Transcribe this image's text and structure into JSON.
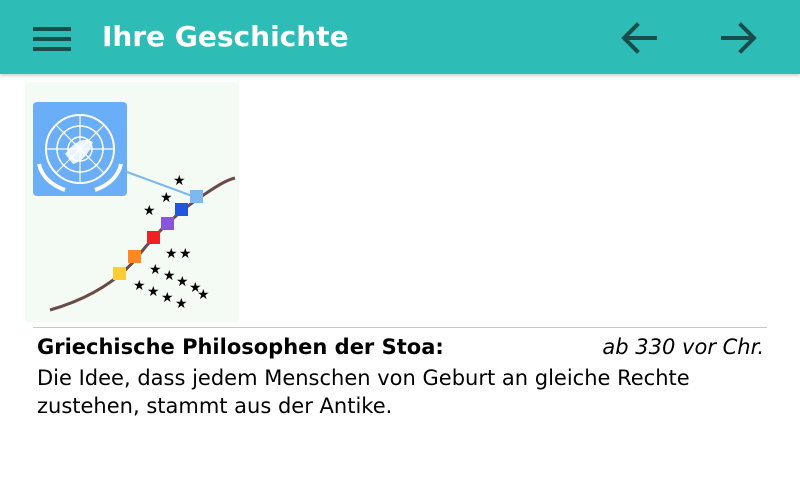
{
  "app_bar": {
    "title": "Ihre Geschichte",
    "menu_icon": "hamburger-menu-icon",
    "back_icon": "arrow-left-icon",
    "forward_icon": "arrow-right-icon",
    "background_color": "#2dbdb6",
    "icon_color": "#174e4b"
  },
  "timeline_image": {
    "icon": "un-emblem-icon",
    "accent_color": "#6aaef7"
  },
  "event": {
    "title": "Griechische Philosophen der Stoa:",
    "date": "ab 330 vor Chr.",
    "description": "Die Idee, dass jedem Menschen von Geburt an gleiche Rechte zustehen, stammt aus der Antike."
  }
}
